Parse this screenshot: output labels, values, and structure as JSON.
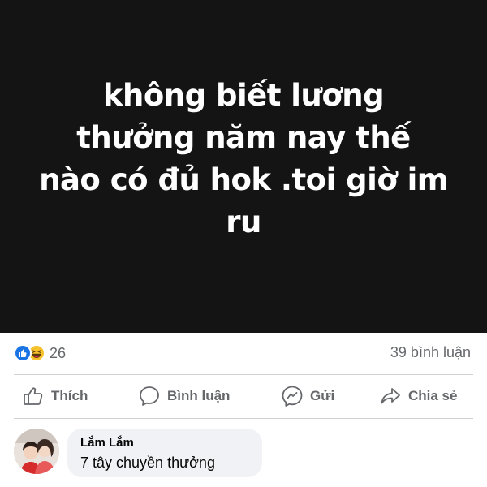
{
  "post": {
    "text_lines": [
      "không biết lương",
      "thưởng năm nay thế",
      "nào có đủ hok .toi giờ im",
      "ru"
    ]
  },
  "stats": {
    "reactions": [
      "like-icon",
      "haha-icon"
    ],
    "reaction_count": "26",
    "comment_count": "39 bình luận"
  },
  "actions": {
    "like_label": "Thích",
    "comment_label": "Bình luận",
    "send_label": "Gửi",
    "share_label": "Chia sẻ"
  },
  "comment": {
    "author": "Lắm Lắm",
    "text": "7 tây chuyền thưởng"
  },
  "colors": {
    "post_background": "#141414",
    "like_blue": "#1b74e4",
    "haha_yellow": "#f7c12c",
    "secondary_text": "#65676b",
    "bubble": "#f0f2f5"
  }
}
